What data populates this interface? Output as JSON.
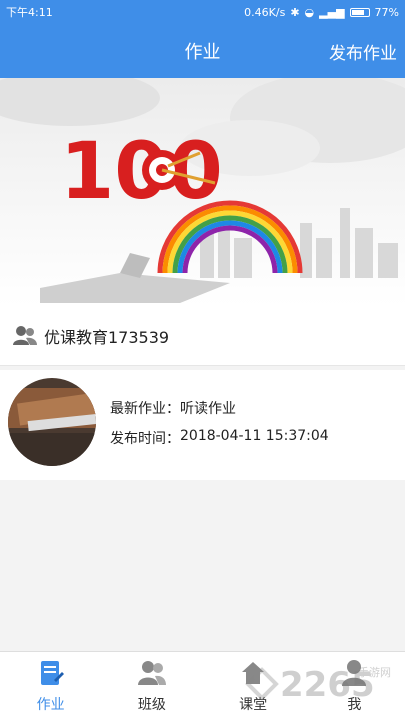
{
  "status_bar": {
    "time": "下午4:11",
    "network_speed": "0.46K/s",
    "battery": "77%",
    "battery_level": 0.77
  },
  "app_bar": {
    "title": "作业",
    "publish_label": "发布作业"
  },
  "banner": {
    "score_text": "100"
  },
  "group": {
    "name": "优课教育173539"
  },
  "homework": {
    "latest_label": "最新作业：",
    "latest_value": "听读作业",
    "time_label": "发布时间：",
    "time_value": "2018-04-11 15:37:04"
  },
  "tabs": [
    {
      "label": "作业",
      "icon": "homework-icon",
      "active": true
    },
    {
      "label": "班级",
      "icon": "class-icon",
      "active": false
    },
    {
      "label": "课堂",
      "icon": "classroom-icon",
      "active": false
    },
    {
      "label": "我",
      "icon": "profile-icon",
      "active": false
    }
  ],
  "watermark": {
    "text": "2265",
    "subtext": "手游网"
  },
  "colors": {
    "primary": "#3f8ee8",
    "tab_active": "#3f8ee8"
  }
}
